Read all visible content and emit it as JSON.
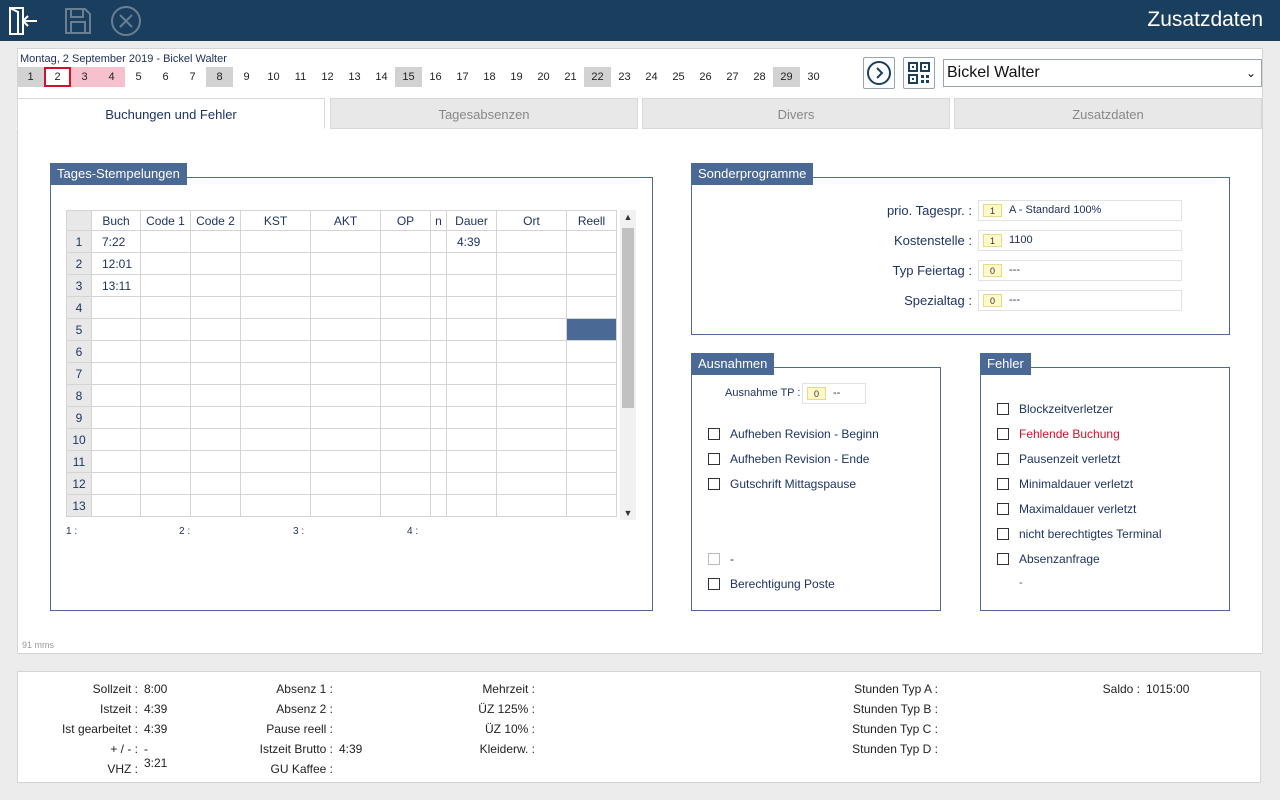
{
  "app": {
    "title": "Zusatzdaten",
    "date_label": "Montag, 2 September 2019 - Bickel Walter",
    "employee_selected": "Bickel Walter",
    "timing": "91 mms"
  },
  "toolbar": {
    "icons": [
      "exit-icon",
      "save-icon",
      "cancel-icon"
    ]
  },
  "days": [
    {
      "d": "1",
      "t": "weekend"
    },
    {
      "d": "2",
      "t": "selected"
    },
    {
      "d": "3",
      "t": "mark"
    },
    {
      "d": "4",
      "t": "mark"
    },
    {
      "d": "5",
      "t": ""
    },
    {
      "d": "6",
      "t": ""
    },
    {
      "d": "7",
      "t": ""
    },
    {
      "d": "8",
      "t": "weekend"
    },
    {
      "d": "9",
      "t": ""
    },
    {
      "d": "10",
      "t": ""
    },
    {
      "d": "11",
      "t": ""
    },
    {
      "d": "12",
      "t": ""
    },
    {
      "d": "13",
      "t": ""
    },
    {
      "d": "14",
      "t": ""
    },
    {
      "d": "15",
      "t": "weekend"
    },
    {
      "d": "16",
      "t": ""
    },
    {
      "d": "17",
      "t": ""
    },
    {
      "d": "18",
      "t": ""
    },
    {
      "d": "19",
      "t": ""
    },
    {
      "d": "20",
      "t": ""
    },
    {
      "d": "21",
      "t": ""
    },
    {
      "d": "22",
      "t": "weekend"
    },
    {
      "d": "23",
      "t": ""
    },
    {
      "d": "24",
      "t": ""
    },
    {
      "d": "25",
      "t": ""
    },
    {
      "d": "26",
      "t": ""
    },
    {
      "d": "27",
      "t": ""
    },
    {
      "d": "28",
      "t": ""
    },
    {
      "d": "29",
      "t": "weekend"
    },
    {
      "d": "30",
      "t": ""
    }
  ],
  "tabs": [
    "Buchungen und Fehler",
    "Tagesabsenzen",
    "Divers",
    "Zusatzdaten"
  ],
  "stempel": {
    "title": "Tages-Stempelungen",
    "columns": [
      "Buch",
      "Code 1",
      "Code 2",
      "KST",
      "AKT",
      "OP",
      "n",
      "Dauer",
      "Ort",
      "Reell"
    ],
    "rows": [
      [
        "1",
        "7:22",
        "",
        "",
        "",
        "",
        "",
        "",
        "4:39",
        "",
        ""
      ],
      [
        "2",
        "12:01",
        "",
        "",
        "",
        "",
        "",
        "",
        "",
        "",
        ""
      ],
      [
        "3",
        "13:11",
        "",
        "",
        "",
        "",
        "",
        "",
        "",
        "",
        ""
      ],
      [
        "4",
        "",
        "",
        "",
        "",
        "",
        "",
        "",
        "",
        "",
        ""
      ],
      [
        "5",
        "",
        "",
        "",
        "",
        "",
        "",
        "",
        "",
        "",
        ""
      ],
      [
        "6",
        "",
        "",
        "",
        "",
        "",
        "",
        "",
        "",
        "",
        ""
      ],
      [
        "7",
        "",
        "",
        "",
        "",
        "",
        "",
        "",
        "",
        "",
        ""
      ],
      [
        "8",
        "",
        "",
        "",
        "",
        "",
        "",
        "",
        "",
        "",
        ""
      ],
      [
        "9",
        "",
        "",
        "",
        "",
        "",
        "",
        "",
        "",
        "",
        ""
      ],
      [
        "10",
        "",
        "",
        "",
        "",
        "",
        "",
        "",
        "",
        "",
        ""
      ],
      [
        "11",
        "",
        "",
        "",
        "",
        "",
        "",
        "",
        "",
        "",
        ""
      ],
      [
        "12",
        "",
        "",
        "",
        "",
        "",
        "",
        "",
        "",
        "",
        ""
      ],
      [
        "13",
        "",
        "",
        "",
        "",
        "",
        "",
        "",
        "",
        "",
        ""
      ]
    ],
    "selected_row": 5,
    "selected_col": "Reell",
    "footer_labels": [
      "1 :",
      "2 :",
      "3 :",
      "4 :"
    ]
  },
  "sonder": {
    "title": "Sonderprogramme",
    "fields": [
      {
        "label": "prio. Tagespr. :",
        "code": "1",
        "value": "A - Standard 100%"
      },
      {
        "label": "Kostenstelle :",
        "code": "1",
        "value": "1100"
      },
      {
        "label": "Typ Feiertag :",
        "code": "0",
        "value": "---"
      },
      {
        "label": "Spezialtag :",
        "code": "0",
        "value": "---"
      }
    ]
  },
  "ausnahmen": {
    "title": "Ausnahmen",
    "tp_label": "Ausnahme TP :",
    "tp_code": "0",
    "tp_value": "--",
    "checks": [
      "Aufheben Revision - Beginn",
      "Aufheben Revision - Ende",
      "Gutschrift Mittagspause"
    ],
    "disabled_check": "-",
    "last_check": "Berechtigung Poste"
  },
  "fehler": {
    "title": "Fehler",
    "checks": [
      {
        "label": "Blockzeitverletzer",
        "error": false
      },
      {
        "label": "Fehlende Buchung",
        "error": true
      },
      {
        "label": "Pausenzeit verletzt",
        "error": false
      },
      {
        "label": "Minimaldauer verletzt",
        "error": false
      },
      {
        "label": "Maximaldauer verletzt",
        "error": false
      },
      {
        "label": "nicht berechtigtes Terminal",
        "error": false
      },
      {
        "label": "Absenzanfrage",
        "error": false
      }
    ],
    "footer_dash": "-"
  },
  "summary": {
    "col1": [
      {
        "k": "Sollzeit :",
        "v": "8:00"
      },
      {
        "k": "Istzeit :",
        "v": "4:39"
      },
      {
        "k": "Ist gearbeitet :",
        "v": "4:39"
      },
      {
        "k": "+ / - :",
        "v": "- 3:21"
      },
      {
        "k": "VHZ :",
        "v": ""
      }
    ],
    "col2": [
      {
        "k": "Absenz 1 :",
        "v": ""
      },
      {
        "k": "Absenz 2 :",
        "v": ""
      },
      {
        "k": "Pause reell :",
        "v": ""
      },
      {
        "k": "Istzeit Brutto :",
        "v": "4:39"
      },
      {
        "k": "GU Kaffee :",
        "v": ""
      }
    ],
    "col3": [
      {
        "k": "Mehrzeit :",
        "v": ""
      },
      {
        "k": "ÜZ 125% :",
        "v": ""
      },
      {
        "k": "ÜZ 10% :",
        "v": ""
      },
      {
        "k": "Kleiderw. :",
        "v": ""
      }
    ],
    "col4": [
      {
        "k": "Stunden Typ A :",
        "v": ""
      },
      {
        "k": "Stunden Typ B :",
        "v": ""
      },
      {
        "k": "Stunden Typ C :",
        "v": ""
      },
      {
        "k": "Stunden Typ D :",
        "v": ""
      }
    ],
    "col5": [
      {
        "k": "Saldo :",
        "v": "1015:00"
      }
    ]
  },
  "colors": {
    "topbar": "#1a3f5e",
    "group_header": "#4b6995",
    "error_text": "#d2102c",
    "weekend": "#d2d2d2",
    "marked_day": "#f6c1cc"
  }
}
